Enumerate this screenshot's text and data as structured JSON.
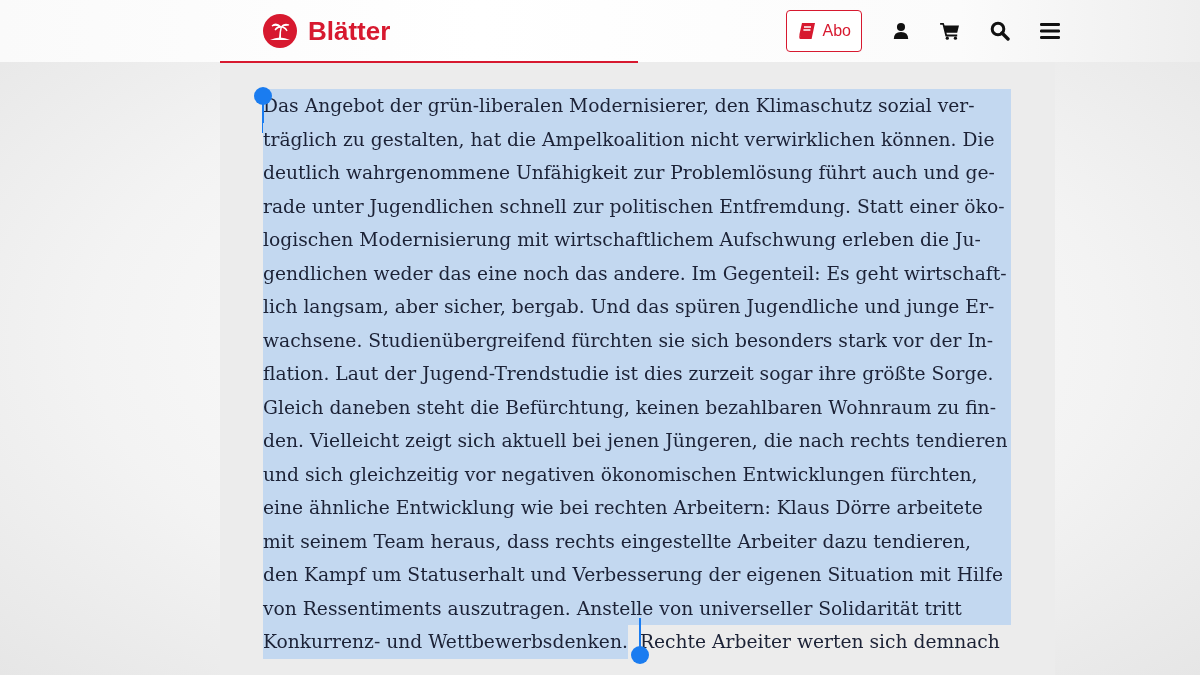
{
  "header": {
    "logo_text": "Blätter",
    "subscribe_button": "Abo",
    "reading_progress": {
      "level": 0.5
    }
  },
  "article": {
    "lines": [
      {
        "segments": [
          {
            "text": "Das Angebot der grün-liberalen Modernisierer, den Klimaschutz sozial ver-",
            "selected": true
          }
        ]
      },
      {
        "segments": [
          {
            "text": "träglich zu gestalten, hat die Ampelkoalition nicht verwirklichen können. Die",
            "selected": true
          }
        ]
      },
      {
        "segments": [
          {
            "text": "deutlich wahrgenommene Unfähigkeit zur Problemlösung führt auch und ge-",
            "selected": true
          }
        ]
      },
      {
        "segments": [
          {
            "text": "rade unter Jugendlichen schnell zur politischen Entfremdung. Statt einer öko-",
            "selected": true
          }
        ]
      },
      {
        "segments": [
          {
            "text": "logischen Modernisierung mit wirtschaftlichem Aufschwung erleben die Ju-",
            "selected": true
          }
        ]
      },
      {
        "segments": [
          {
            "text": "gendlichen weder das eine noch das andere. Im Gegenteil: Es geht wirtschaft-",
            "selected": true
          }
        ]
      },
      {
        "segments": [
          {
            "text": "lich langsam, aber sicher, bergab. Und das spüren Jugendliche und junge Er-",
            "selected": true
          }
        ]
      },
      {
        "segments": [
          {
            "text": "wachsene. Studienübergreifend fürchten sie sich besonders stark vor der In-",
            "selected": true
          }
        ]
      },
      {
        "segments": [
          {
            "text": "flation. Laut der Jugend-Trendstudie ist dies zurzeit sogar ihre größte Sorge.",
            "selected": true
          }
        ]
      },
      {
        "segments": [
          {
            "text": "Gleich daneben steht die Befürchtung, keinen bezahlbaren Wohnraum zu fin-",
            "selected": true
          }
        ]
      },
      {
        "segments": [
          {
            "text": "den. Vielleicht zeigt sich aktuell bei jenen Jüngeren, die nach rechts tendieren",
            "selected": true
          }
        ]
      },
      {
        "segments": [
          {
            "text": "und sich gleichzeitig vor negativen ökonomischen Entwicklungen fürchten,",
            "selected": true
          }
        ]
      },
      {
        "segments": [
          {
            "text": "eine ähnliche Entwicklung wie bei rechten Arbeitern: Klaus Dörre arbeitete",
            "selected": true
          }
        ]
      },
      {
        "segments": [
          {
            "text": "mit seinem Team heraus, dass rechts eingestellte Arbeiter dazu tendieren,",
            "selected": true
          }
        ]
      },
      {
        "segments": [
          {
            "text": "den Kampf um Statuserhalt und Verbesserung der eigenen Situation mit Hilfe",
            "selected": true
          }
        ]
      },
      {
        "segments": [
          {
            "text": "von Ressentiments auszutragen. Anstelle von universeller Solidarität tritt",
            "selected": true
          }
        ]
      },
      {
        "segments": [
          {
            "text": "Konkurrenz- und Wettbewerbsdenken.",
            "selected": true
          },
          {
            "text": "Rechte Arbeiter werten sich demnach",
            "selected": false
          }
        ]
      }
    ]
  }
}
